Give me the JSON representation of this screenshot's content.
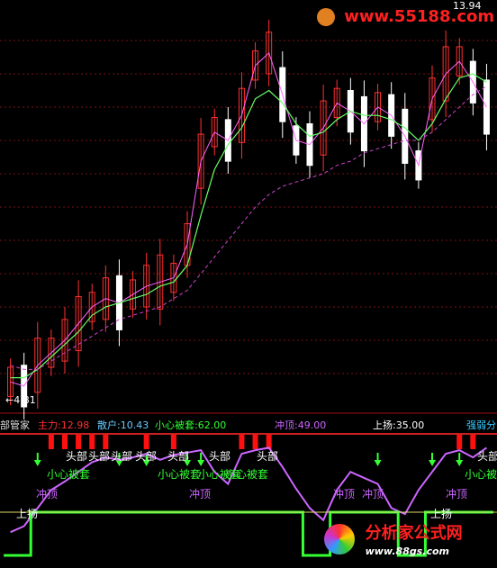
{
  "watermark_top": {
    "text": "www.55188.com",
    "color": "#ff2020"
  },
  "watermark_bottom": {
    "brand": "分析家公式网",
    "url": "www.88gs.com"
  },
  "price_labels": {
    "high": "13.94",
    "low": "←4.81"
  },
  "indicator_header": {
    "name": "部管家",
    "items": [
      {
        "label": "主力:",
        "value": "12.98",
        "color": "#ff3030"
      },
      {
        "label": "散户:",
        "value": "10.43",
        "color": "#66ccff"
      },
      {
        "label": "小心被套:",
        "value": "62.00",
        "color": "#33ff33"
      },
      {
        "label": "冲顶:",
        "value": "49.00",
        "color": "#cc66ff"
      },
      {
        "label": "上扬:",
        "value": "35.00",
        "color": "#ffffff"
      },
      {
        "label": "强弱分",
        "value": "",
        "color": "#33ccff"
      }
    ]
  },
  "signal_labels": [
    {
      "text": "头部",
      "color": "#ffffff"
    },
    {
      "text": "头部",
      "color": "#ffffff"
    },
    {
      "text": "头部",
      "color": "#ffffff"
    },
    {
      "text": "头部",
      "color": "#ffffff"
    },
    {
      "text": "头部",
      "color": "#ffffff"
    },
    {
      "text": "头部",
      "color": "#ffffff"
    },
    {
      "text": "头部",
      "color": "#ffffff"
    },
    {
      "text": "头部",
      "color": "#ffffff"
    },
    {
      "text": "小心被套",
      "color": "#33ff33"
    },
    {
      "text": "小心被套",
      "color": "#33ff33"
    },
    {
      "text": "小心被套",
      "color": "#33ff33"
    },
    {
      "text": "小心被套",
      "color": "#33ff33"
    },
    {
      "text": "小心被",
      "color": "#33ff33"
    },
    {
      "text": "冲顶",
      "color": "#cc66ff"
    },
    {
      "text": "冲顶",
      "color": "#cc66ff"
    },
    {
      "text": "冲顶",
      "color": "#cc66ff"
    },
    {
      "text": "冲顶",
      "color": "#cc66ff"
    },
    {
      "text": "冲顶",
      "color": "#cc66ff"
    },
    {
      "text": "上扬",
      "color": "#ffffff"
    },
    {
      "text": "上扬",
      "color": "#ffffff"
    }
  ],
  "chart_data": [
    {
      "type": "line",
      "title": "",
      "description_note": "",
      "series": [
        {
          "values": [
            5.2,
            5.1,
            5.6,
            5.9,
            6.2,
            6.6,
            7.0,
            7.2,
            7.1,
            7.3,
            7.5,
            7.6,
            7.7,
            8.5,
            10.5,
            11.2,
            11.0,
            11.6,
            12.8,
            13.1,
            12.1,
            11.0,
            10.9,
            11.3,
            11.9,
            11.7,
            11.4,
            11.8,
            11.6,
            11.1,
            10.4,
            12.0,
            12.6,
            12.9,
            12.4,
            11.8
          ]
        },
        {
          "values": [
            5.3,
            5.3,
            5.5,
            5.8,
            6.1,
            6.4,
            6.8,
            7.0,
            7.1,
            7.2,
            7.3,
            7.5,
            7.6,
            8.0,
            9.2,
            10.3,
            10.9,
            11.3,
            12.0,
            12.2,
            11.9,
            11.4,
            11.1,
            11.2,
            11.5,
            11.7,
            11.6,
            11.6,
            11.5,
            11.3,
            11.0,
            11.4,
            12.0,
            12.5,
            12.6,
            12.4
          ]
        },
        {
          "values": [
            5.6,
            5.5,
            5.5,
            5.7,
            5.9,
            6.1,
            6.3,
            6.5,
            6.7,
            6.8,
            6.9,
            7.0,
            7.2,
            7.4,
            7.8,
            8.2,
            8.6,
            9.0,
            9.4,
            9.7,
            9.9,
            10.0,
            10.1,
            10.2,
            10.4,
            10.5,
            10.7,
            10.8,
            10.9,
            11.0,
            11.0,
            11.2,
            11.5,
            11.8,
            12.1,
            12.3
          ]
        }
      ],
      "ylim": [
        4.6,
        14.2
      ],
      "grid": true
    },
    {
      "type": "line",
      "title": "",
      "series": [
        {
          "values": [
            20,
            25,
            40,
            55,
            62,
            70,
            78,
            82,
            80,
            82,
            85,
            80,
            84,
            86,
            88,
            70,
            60,
            85,
            88,
            90,
            74,
            56,
            40,
            30,
            55,
            70,
            65,
            60,
            40,
            35,
            55,
            70,
            85,
            88,
            82,
            90
          ]
        },
        {
          "values": [
            0,
            0,
            100,
            100,
            100,
            100,
            100,
            100,
            100,
            100,
            100,
            100,
            100,
            100,
            100,
            100,
            100,
            100,
            100,
            100,
            100,
            100,
            0,
            0,
            100,
            100,
            100,
            100,
            100,
            0,
            0,
            100,
            100,
            100,
            100,
            100
          ]
        }
      ],
      "ylim": [
        0,
        100
      ],
      "grid": false
    }
  ]
}
